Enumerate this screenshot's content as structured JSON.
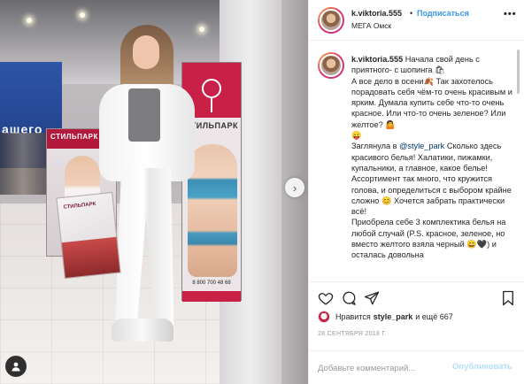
{
  "photo": {
    "shop_sign": "ашего",
    "banner_left_title": "СТИЛЬПАРК",
    "banner_right_name": "СТИЛЬПАРК",
    "banner_right_phone": "8 800 700 48 68",
    "bag_logo": "СТИЛЬПАРК"
  },
  "header": {
    "username": "k.viktoria.555",
    "separator": "•",
    "follow_label": "Подписаться",
    "location": "МЕГА Омск",
    "more": "•••"
  },
  "caption": {
    "username": "k.viktoria.555",
    "part1": " Начала свой день с приятного- с шопинга 🛍\nА все дело в осени🍂 Так захотелось порадовать себя чём-то очень красивым и ярким. Думала купить себе что-то очень красное. Или что-то очень зеленое? Или желтое? 🤷\n😛\nЗаглянула в ",
    "mention": "@style_park",
    "part2": " Сколько здесь красивого белья! Халатики, пижамки, купальники, а главное, какое белье! Ассортимент так много, что кружится голова, и определиться с выбором крайне сложно 😊 Хочется забрать практически всё!\nПриобрела себе 3 комплектика белья на любой случай (P.S. красное, зеленое, но вместо желтого взяла черный 😄🖤) и осталась довольна"
  },
  "likes": {
    "prefix": "Нравится",
    "user": "style_park",
    "suffix": "и ещё 667"
  },
  "date": "28 СЕНТЯБРЯ 2018 Г.",
  "comment_box": {
    "placeholder": "Добавьте комментарий...",
    "post_label": "Опубликовать"
  }
}
